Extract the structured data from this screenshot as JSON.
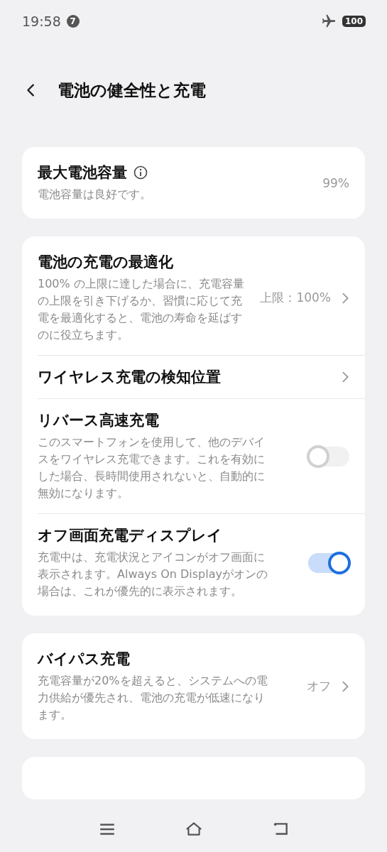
{
  "status_bar": {
    "time": "19:58",
    "notification_count": "7",
    "battery": "100"
  },
  "header": {
    "title": "電池の健全性と充電"
  },
  "cards": [
    {
      "items": [
        {
          "kind": "value",
          "title": "最大電池容量",
          "info": true,
          "description": "電池容量は良好です。",
          "value": "99%"
        }
      ]
    },
    {
      "items": [
        {
          "kind": "nav",
          "title": "電池の充電の最適化",
          "description": "100% の上限に達した場合に、充電容量の上限を引き下げるか、習慣に応じて充電を最適化すると、電池の寿命を延ばすのに役立ちます。",
          "value": "上限：100%"
        },
        {
          "kind": "nav",
          "title": "ワイヤレス充電の検知位置"
        },
        {
          "kind": "toggle",
          "title": "リバース高速充電",
          "description": "このスマートフォンを使用して、他のデバイスをワイヤレス充電できます。これを有効にした場合、長時間使用されないと、自動的に無効になります。",
          "on": false
        },
        {
          "kind": "toggle",
          "title": "オフ画面充電ディスプレイ",
          "description": "充電中は、充電状況とアイコンがオフ画面に表示されます。Always On Displayがオンの場合は、これが優先的に表示されます。",
          "on": true
        }
      ]
    },
    {
      "items": [
        {
          "kind": "nav",
          "title": "バイパス充電",
          "description": "充電容量が20%を超えると、システムへの電力供給が優先され、電池の充電が低速になります。",
          "value": "オフ"
        }
      ]
    },
    {
      "kind": "blank"
    }
  ]
}
